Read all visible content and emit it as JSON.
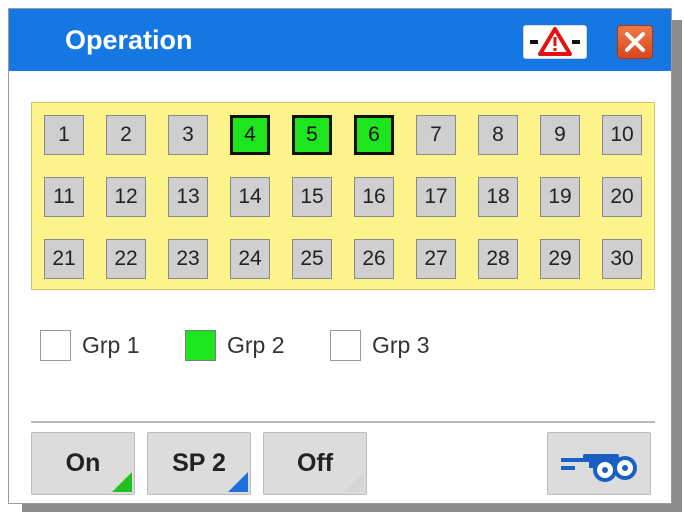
{
  "window": {
    "title": "Operation",
    "warning_button": "warning-triangle-icon",
    "close_button": "close-icon"
  },
  "sections": [
    {
      "label": "1",
      "active": false
    },
    {
      "label": "2",
      "active": false
    },
    {
      "label": "3",
      "active": false
    },
    {
      "label": "4",
      "active": true
    },
    {
      "label": "5",
      "active": true
    },
    {
      "label": "6",
      "active": true
    },
    {
      "label": "7",
      "active": false
    },
    {
      "label": "8",
      "active": false
    },
    {
      "label": "9",
      "active": false
    },
    {
      "label": "10",
      "active": false
    },
    {
      "label": "11",
      "active": false
    },
    {
      "label": "12",
      "active": false
    },
    {
      "label": "13",
      "active": false
    },
    {
      "label": "14",
      "active": false
    },
    {
      "label": "15",
      "active": false
    },
    {
      "label": "16",
      "active": false
    },
    {
      "label": "17",
      "active": false
    },
    {
      "label": "18",
      "active": false
    },
    {
      "label": "19",
      "active": false
    },
    {
      "label": "20",
      "active": false
    },
    {
      "label": "21",
      "active": false
    },
    {
      "label": "22",
      "active": false
    },
    {
      "label": "23",
      "active": false
    },
    {
      "label": "24",
      "active": false
    },
    {
      "label": "25",
      "active": false
    },
    {
      "label": "26",
      "active": false
    },
    {
      "label": "27",
      "active": false
    },
    {
      "label": "28",
      "active": false
    },
    {
      "label": "29",
      "active": false
    },
    {
      "label": "30",
      "active": false
    }
  ],
  "groups": [
    {
      "label": "Grp 1",
      "checked": false
    },
    {
      "label": "Grp 2",
      "checked": true
    },
    {
      "label": "Grp 3",
      "checked": false
    }
  ],
  "buttons": {
    "on": {
      "label": "On",
      "corner_color": "#1fc21f"
    },
    "sp2": {
      "label": "SP 2",
      "corner_color": "#1f6fe0"
    },
    "off": {
      "label": "Off",
      "corner_color": "#d6d6d6"
    },
    "sprayer": {
      "icon": "sprayer-icon"
    }
  },
  "colors": {
    "titlebar": "#1577e2",
    "section_active": "#1ee61e",
    "section_inactive": "#cfcfcf",
    "grid_background": "#fcf48a"
  }
}
